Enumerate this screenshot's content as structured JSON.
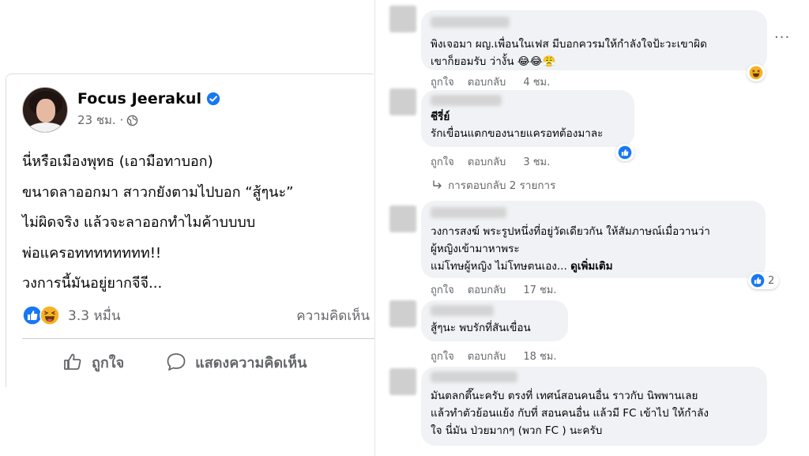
{
  "post": {
    "author": "Focus Jeerakul",
    "time": "23 ชม. ·",
    "lines": [
      "นี่หรือเมืองพุทธ (เอามือทาบอก)",
      "ขนาดลาออกมา สาวกยังตามไปบอก “สู้ๆนะ”",
      "ไม่ผิดจริง แล้วจะลาออกทำไมค้าบบบบ",
      "พ่อแครอทททททททท!!",
      "วงการนี้มันอยู่ยากจีจี..."
    ],
    "reactions": {
      "count": "3.3 หมื่น",
      "icons": [
        "like-icon",
        "haha-icon"
      ]
    },
    "comments_label": "ความคิดเห็น",
    "actions": {
      "like": "ถูกใจ",
      "comment": "แสดงความคิดเห็น"
    }
  },
  "comments": [
    {
      "lines": [
        "พิงเจอมา ผญ.เพื่อนในเฟส มีบอกควรมให้กำลังใจป้ะวะเขาผิด",
        "เขาก็ยอมรับ ว่างั้น 😂😂😤"
      ],
      "footer": {
        "like": "ถูกใจ",
        "reply": "ตอบกลับ",
        "time": "4 ชม."
      },
      "reaction": {
        "icon": "haha-icon",
        "count": ""
      }
    },
    {
      "author": "ชีรี่ย์",
      "lines": [
        "รักเขื่อนแตกของนายแครอทต้องมาละ"
      ],
      "footer": {
        "like": "ถูกใจ",
        "reply": "ตอบกลับ",
        "time": "3 ชม."
      },
      "reaction": {
        "icon": "like-icon",
        "count": ""
      },
      "replies": "การตอบกลับ 2 รายการ"
    },
    {
      "lines": [
        "วงการสงฆ์ พระรูปหนึ่งที่อยู่วัดเดียวกัน ให้สัมภาษณ์เมื่อวานว่า",
        "ผู้หญิงเข้ามาหาพระ",
        "แม่โทษผู้หญิง ไม่โทษตนเอง..."
      ],
      "see_more": "ดูเพิ่มเติม",
      "footer": {
        "like": "ถูกใจ",
        "reply": "ตอบกลับ",
        "time": "17 ชม."
      },
      "reaction": {
        "icon": "like-icon",
        "count": "2"
      }
    },
    {
      "lines": [
        "สู้ๆนะ พบรักที่สันเขื่อน"
      ],
      "footer": {
        "like": "ถูกใจ",
        "reply": "ตอบกลับ",
        "time": "18 ชม."
      }
    },
    {
      "lines": [
        "มันตลกตึ๊นะครับ ตรงที่ เทศน์สอนคนอื่น ราวกับ นิพพานเลย",
        "แล้วทำตัวย้อนแย้ง กับที่ สอนคนอื่น แล้วมี FC เข้าไป ให้กำลัง",
        "ใจ นี่มัน ป่วยมากๆ (พวก FC ) นะครับ"
      ]
    }
  ],
  "more_options": "···",
  "colors": {
    "link_blue": "#1877f2",
    "bubble_bg": "#f0f2f5",
    "meta_gray": "#65676b"
  }
}
